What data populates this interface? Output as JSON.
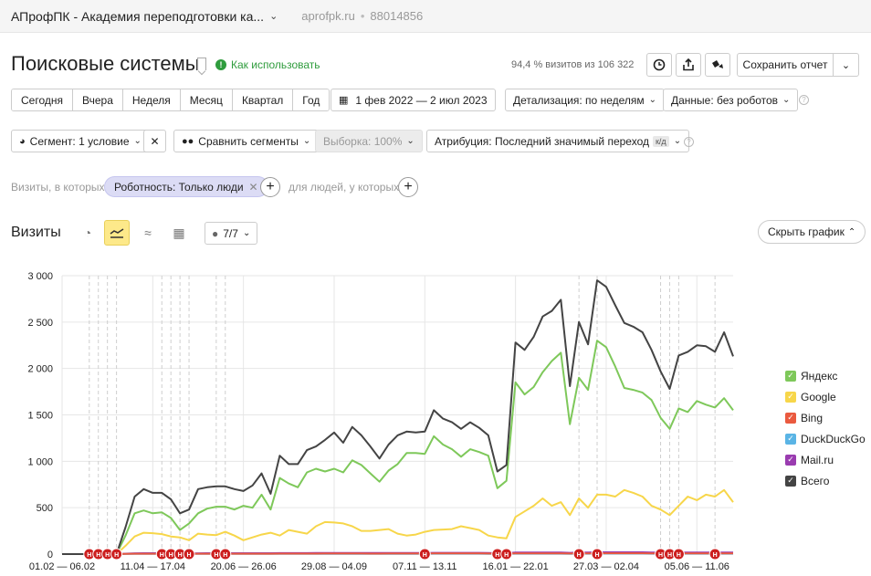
{
  "topbar": {
    "counter_name": "АПрофПК - Академия переподготовки ка...",
    "domain": "aprofpk.ru",
    "separator": "•",
    "counter_id": "88014856"
  },
  "header": {
    "title": "Поисковые системы",
    "howto": "Как использовать",
    "visits_share": "94,4 % визитов из 106 322",
    "save_label": "Сохранить отчет"
  },
  "periods": [
    "Сегодня",
    "Вчера",
    "Неделя",
    "Месяц",
    "Квартал",
    "Год"
  ],
  "date_range": "1 фев 2022 — 2 июл 2023",
  "detail": "Детализация: по неделям",
  "data_mode": "Данные: без роботов",
  "segment": "Сегмент: 1 условие",
  "compare": "Сравнить сегменты",
  "sample": "Выборка: 100%",
  "attribution": "Атрибуция: Последний значимый переход",
  "attribution_badge": "к/д",
  "filters": {
    "visits_label": "Визиты, в которых",
    "chip": "Робот­ность: Только люди",
    "people_label": "для людей, у которых"
  },
  "chart_section": {
    "title": "Визиты",
    "notes": "7/7",
    "hide": "Скрыть график"
  },
  "colors": {
    "yandex": "#7ec85a",
    "google": "#f7d64a",
    "bing": "#ea5a3f",
    "duckduckgo": "#5ab4e5",
    "mailru": "#9a3cb0",
    "total": "#444444",
    "marker": "#cc1f1f"
  },
  "chart_data": {
    "type": "line",
    "ylim": [
      0,
      3000
    ],
    "yticks": [
      0,
      500,
      1000,
      1500,
      2000,
      2500,
      3000
    ],
    "ytick_labels": [
      "0",
      "500",
      "1 000",
      "1 500",
      "2 000",
      "2 500",
      "3 000"
    ],
    "xtick_labels": [
      "01.02 — 06.02",
      "11.04 — 17.04",
      "20.06 — 26.06",
      "29.08 — 04.09",
      "07.11 — 13.11",
      "16.01 — 22.01",
      "27.03 — 02.04",
      "05.06 — 11.06"
    ],
    "xtick_index": [
      0,
      10,
      20,
      30,
      40,
      50,
      60,
      70
    ],
    "marker_label": "Н",
    "markers": [
      3,
      4,
      5,
      6,
      11,
      12,
      13,
      14,
      17,
      18,
      40,
      48,
      49,
      57,
      59,
      66,
      67,
      68,
      72
    ],
    "event_lines": [
      3,
      4,
      5,
      6,
      11,
      12,
      13,
      14,
      17,
      18,
      57,
      59,
      66,
      67,
      68,
      72
    ],
    "series": [
      {
        "name": "Яндекс",
        "key": "yandex",
        "values": [
          0,
          0,
          0,
          0,
          0,
          0,
          0,
          200,
          440,
          470,
          440,
          450,
          390,
          260,
          330,
          440,
          490,
          510,
          510,
          480,
          520,
          500,
          640,
          480,
          820,
          760,
          720,
          880,
          920,
          890,
          920,
          880,
          1010,
          960,
          870,
          780,
          900,
          970,
          1090,
          1090,
          1080,
          1270,
          1180,
          1130,
          1050,
          1130,
          1100,
          1060,
          710,
          790,
          1850,
          1720,
          1800,
          1960,
          2080,
          2170,
          1400,
          1900,
          1770,
          2300,
          2230,
          2020,
          1790,
          1770,
          1740,
          1660,
          1470,
          1350,
          1570,
          1530,
          1650,
          1610,
          1580,
          1680,
          1550
        ]
      },
      {
        "name": "Google",
        "key": "google",
        "values": [
          0,
          0,
          0,
          0,
          0,
          0,
          0,
          90,
          190,
          230,
          225,
          215,
          190,
          180,
          150,
          220,
          210,
          205,
          240,
          200,
          150,
          180,
          210,
          230,
          200,
          260,
          240,
          220,
          300,
          345,
          340,
          330,
          300,
          250,
          250,
          260,
          270,
          220,
          200,
          210,
          240,
          260,
          265,
          270,
          300,
          280,
          260,
          200,
          180,
          170,
          400,
          460,
          520,
          600,
          520,
          560,
          420,
          600,
          500,
          640,
          640,
          620,
          690,
          660,
          620,
          520,
          480,
          420,
          520,
          620,
          580,
          640,
          620,
          690,
          560
        ]
      },
      {
        "name": "Bing",
        "key": "bing",
        "values": [
          0,
          0,
          0,
          0,
          0,
          0,
          0,
          2,
          4,
          4,
          4,
          4,
          4,
          3,
          3,
          4,
          4,
          4,
          4,
          4,
          4,
          4,
          4,
          4,
          5,
          5,
          5,
          5,
          5,
          6,
          6,
          6,
          6,
          6,
          5,
          5,
          6,
          6,
          6,
          6,
          6,
          7,
          7,
          7,
          7,
          7,
          7,
          6,
          5,
          5,
          8,
          8,
          8,
          8,
          8,
          8,
          6,
          8,
          8,
          9,
          9,
          9,
          9,
          9,
          9,
          8,
          8,
          7,
          8,
          8,
          8,
          8,
          8,
          8,
          8
        ]
      },
      {
        "name": "DuckDuckGo",
        "key": "duckduckgo",
        "values": [
          0,
          0,
          0,
          0,
          0,
          0,
          0,
          1,
          2,
          2,
          2,
          2,
          2,
          2,
          2,
          2,
          2,
          2,
          2,
          2,
          2,
          2,
          2,
          2,
          3,
          3,
          3,
          3,
          3,
          3,
          3,
          3,
          3,
          3,
          3,
          3,
          3,
          3,
          3,
          3,
          3,
          4,
          4,
          4,
          4,
          4,
          4,
          3,
          3,
          3,
          4,
          4,
          4,
          4,
          4,
          4,
          3,
          4,
          4,
          5,
          5,
          5,
          5,
          5,
          5,
          4,
          4,
          4,
          4,
          4,
          4,
          4,
          4,
          4,
          4
        ]
      },
      {
        "name": "Mail.ru",
        "key": "mailru",
        "values": [
          0,
          0,
          0,
          0,
          0,
          0,
          0,
          5,
          9,
          10,
          10,
          10,
          10,
          8,
          8,
          9,
          10,
          10,
          10,
          10,
          10,
          10,
          10,
          10,
          11,
          11,
          11,
          11,
          12,
          12,
          12,
          12,
          12,
          12,
          12,
          12,
          12,
          12,
          12,
          12,
          12,
          14,
          14,
          14,
          14,
          14,
          14,
          12,
          10,
          10,
          18,
          18,
          18,
          18,
          18,
          18,
          14,
          18,
          18,
          20,
          20,
          20,
          20,
          20,
          20,
          18,
          18,
          16,
          18,
          18,
          18,
          18,
          18,
          18,
          18
        ]
      },
      {
        "name": "Всего",
        "key": "total",
        "values": [
          0,
          0,
          0,
          0,
          0,
          0,
          0,
          290,
          620,
          700,
          660,
          660,
          590,
          440,
          480,
          700,
          720,
          730,
          730,
          700,
          680,
          740,
          870,
          650,
          1060,
          970,
          970,
          1120,
          1160,
          1230,
          1310,
          1200,
          1370,
          1280,
          1160,
          1030,
          1180,
          1280,
          1320,
          1310,
          1320,
          1550,
          1460,
          1420,
          1350,
          1420,
          1360,
          1280,
          890,
          960,
          2280,
          2200,
          2340,
          2560,
          2620,
          2740,
          1810,
          2500,
          2260,
          2950,
          2880,
          2680,
          2490,
          2450,
          2390,
          2200,
          1970,
          1780,
          2140,
          2180,
          2250,
          2240,
          2180,
          2390,
          2130
        ]
      }
    ]
  }
}
